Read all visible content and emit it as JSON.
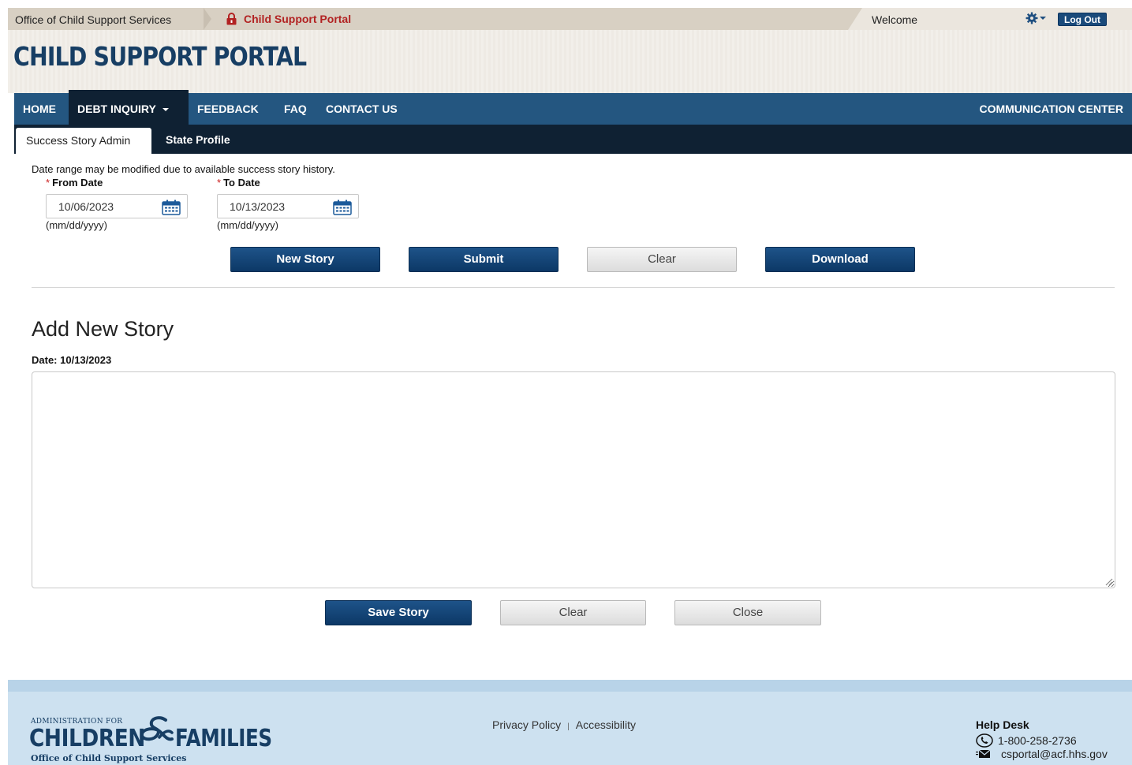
{
  "topbar": {
    "office_link": "Office of Child Support Services",
    "portal_link": "Child Support Portal",
    "welcome": "Welcome",
    "logout": "Log Out"
  },
  "header": {
    "title": "CHILD SUPPORT PORTAL"
  },
  "nav": {
    "items": [
      "HOME",
      "DEBT INQUIRY",
      "FEEDBACK",
      "FAQ",
      "CONTACT US"
    ],
    "active": "DEBT INQUIRY",
    "right": "COMMUNICATION CENTER"
  },
  "subnav": {
    "tabs": [
      "Success Story Admin",
      "State Profile"
    ],
    "active": "Success Story Admin"
  },
  "filters": {
    "note": "Date range may be modified due to available success story history.",
    "from_label": "From Date",
    "from_value": "10/06/2023",
    "to_label": "To Date",
    "to_value": "10/13/2023",
    "format_hint": "(mm/dd/yyyy)",
    "required_mark": "*"
  },
  "actions": {
    "new_story": "New Story",
    "submit": "Submit",
    "clear": "Clear",
    "download": "Download"
  },
  "story": {
    "title": "Add New Story",
    "date_label": "Date: 10/13/2023",
    "text": "",
    "save": "Save Story",
    "clear": "Clear",
    "close": "Close"
  },
  "footer": {
    "logo_top": "ADMINISTRATION FOR",
    "logo_children": "CHILDREN",
    "logo_families": "FAMILIES",
    "logo_sub": "Office of Child Support Services",
    "privacy": "Privacy Policy",
    "separator": "|",
    "accessibility": "Accessibility",
    "help_title": "Help Desk",
    "phone": "1-800-258-2736",
    "email": "csportal@acf.hhs.gov"
  },
  "colors": {
    "brand_navy": "#173e64",
    "nav_blue": "#245680",
    "nav_dark": "#0f2133",
    "button_blue": "#0c3866",
    "required_red": "#cc2222",
    "footer_bg": "#cde1f0"
  }
}
